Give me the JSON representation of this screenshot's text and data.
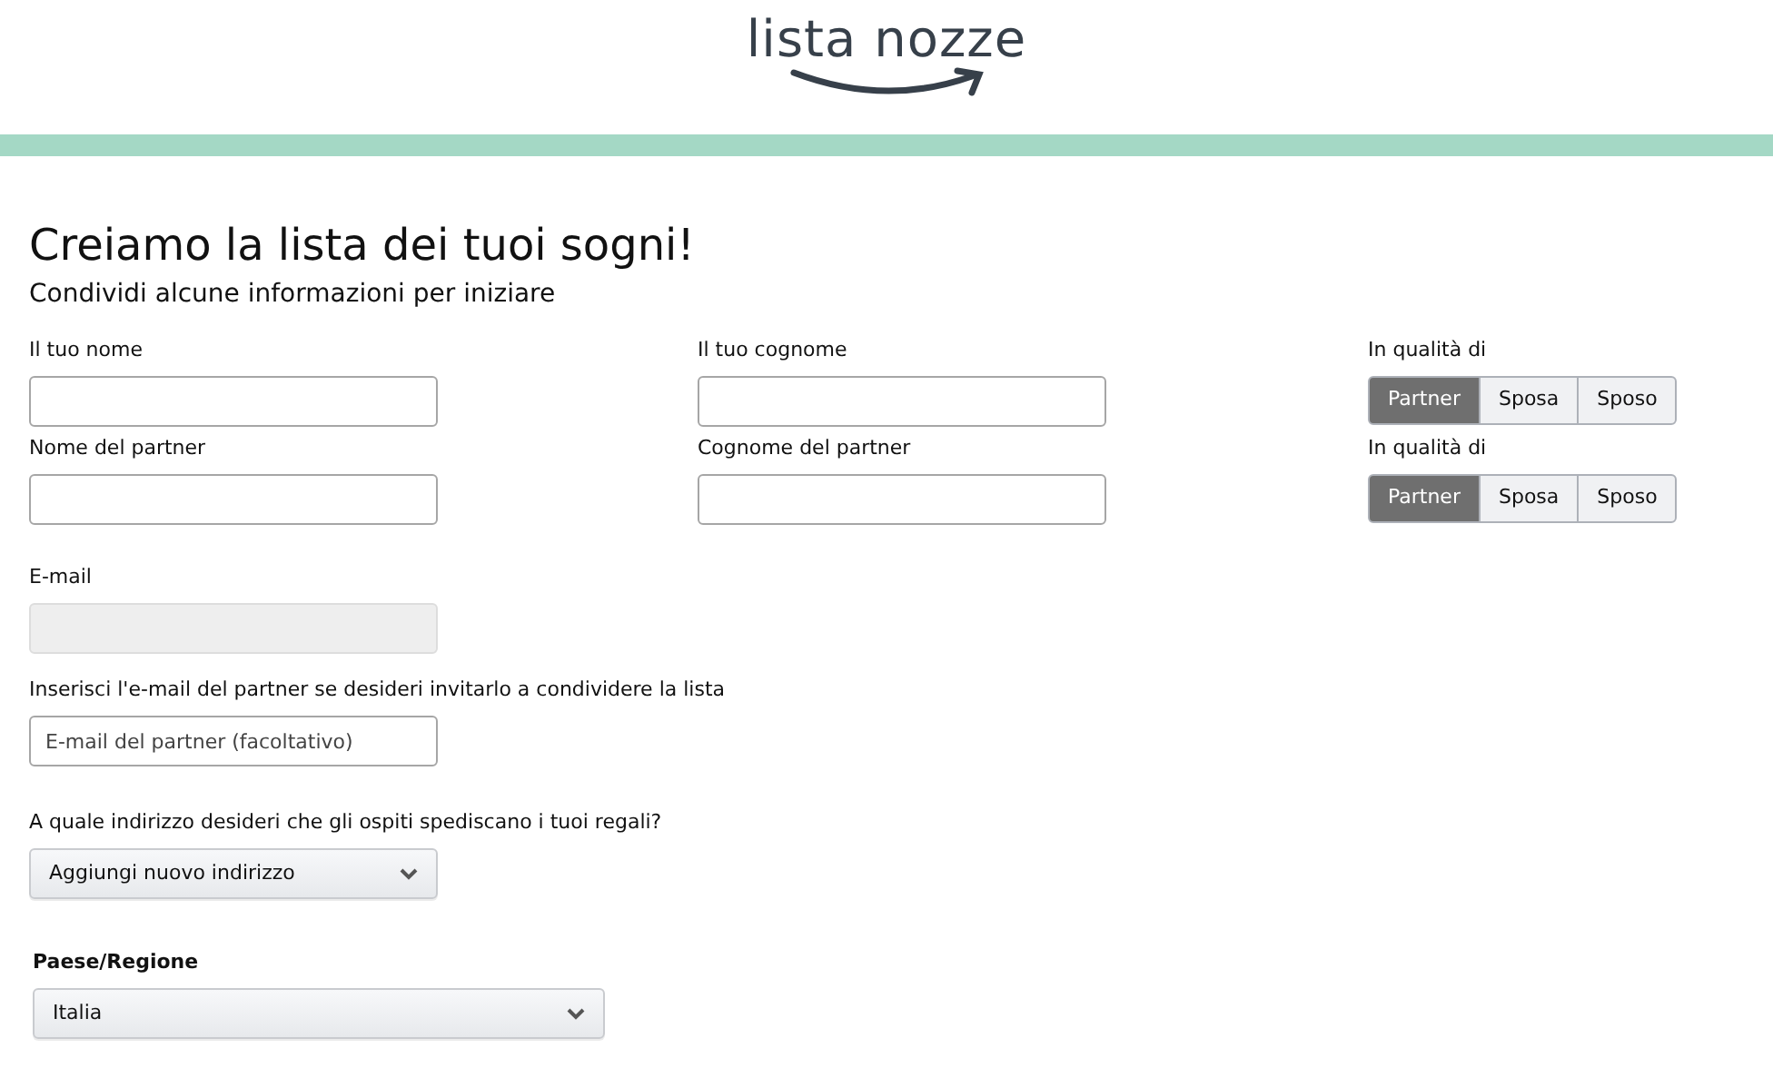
{
  "logo": {
    "text": "lista nozze"
  },
  "heading": "Creiamo la lista dei tuoi sogni!",
  "subheading": "Condividi alcune informazioni per iniziare",
  "name_rows": [
    {
      "first": {
        "label": "Il tuo nome"
      },
      "second": {
        "label": "Il tuo cognome"
      },
      "role": {
        "label": "In qualità di",
        "options": [
          {
            "label": "Partner",
            "selected": true
          },
          {
            "label": "Sposa",
            "selected": false
          },
          {
            "label": "Sposo",
            "selected": false
          }
        ]
      }
    },
    {
      "first": {
        "label": "Nome del partner"
      },
      "second": {
        "label": "Cognome del partner"
      },
      "role": {
        "label": "In qualità di",
        "options": [
          {
            "label": "Partner",
            "selected": true
          },
          {
            "label": "Sposa",
            "selected": false
          },
          {
            "label": "Sposo",
            "selected": false
          }
        ]
      }
    }
  ],
  "email": {
    "label": "E-mail",
    "disabled": true
  },
  "partner_email": {
    "label": "Inserisci l'e-mail del partner se desideri invitarlo a condividere la lista",
    "placeholder": "E-mail del partner (facoltativo)"
  },
  "address": {
    "label": "A quale indirizzo desideri che gli ospiti spediscano i tuoi regali?",
    "value": "Aggiungi nuovo indirizzo"
  },
  "country": {
    "label": "Paese/Regione",
    "value": "Italia"
  }
}
